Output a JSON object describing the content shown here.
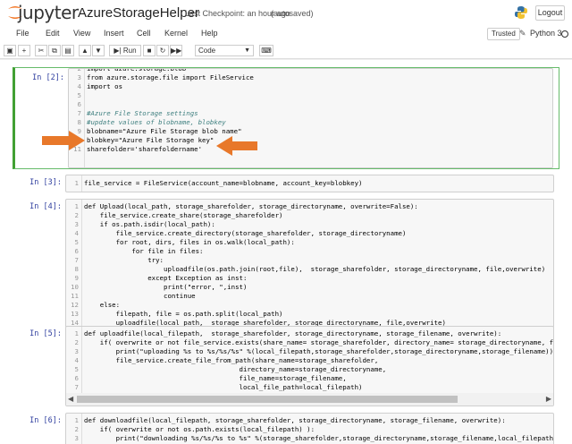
{
  "header": {
    "logo_text": "jupyter",
    "notebook_name": "AzureStorageHelper",
    "checkpoint": "Last Checkpoint: an hour ago",
    "autosave": "(autosaved)",
    "logout_label": "Logout"
  },
  "menubar": {
    "items": [
      "File",
      "Edit",
      "View",
      "Insert",
      "Cell",
      "Kernel",
      "Help"
    ],
    "trusted_label": "Trusted",
    "kernel_name": "Python 3"
  },
  "toolbar": {
    "run_label": "Run",
    "cell_type": "Code"
  },
  "cells": [
    {
      "prompt": "In [2]:",
      "selected": true,
      "lines": [
        {
          "n": "3",
          "text": "from azure.storage.file import FileService"
        },
        {
          "n": "4",
          "text": "import os"
        },
        {
          "n": "5",
          "text": ""
        },
        {
          "n": "6",
          "text": ""
        },
        {
          "n": "7",
          "text": "#Azure File Storage settings"
        },
        {
          "n": "8",
          "text": "#update values of blobname, blobkey"
        },
        {
          "n": "9",
          "text": "blobname=\"Azure File Storage blob name\""
        },
        {
          "n": "10",
          "text": "blobkey=\"Azure File Storage key\""
        },
        {
          "n": "11",
          "text": "sharefolder='sharefoldername'"
        }
      ]
    },
    {
      "prompt": "In [3]:",
      "lines": [
        {
          "n": "1",
          "text": "file_service = FileService(account_name=blobname, account_key=blobkey)"
        }
      ]
    },
    {
      "prompt": "In [4]:",
      "lines": [
        {
          "n": "1",
          "text": "def Upload(local_path, storage_sharefolder, storage_directoryname, overwrite=False):"
        },
        {
          "n": "2",
          "text": "    file_service.create_share(storage_sharefolder)"
        },
        {
          "n": "3",
          "text": "    if os.path.isdir(local_path):"
        },
        {
          "n": "4",
          "text": "        file_service.create_directory(storage_sharefolder, storage_directoryname)"
        },
        {
          "n": "5",
          "text": "        for root, dirs, files in os.walk(local_path):"
        },
        {
          "n": "6",
          "text": "            for file in files:"
        },
        {
          "n": "7",
          "text": "                try:"
        },
        {
          "n": "8",
          "text": "                    uploadfile(os.path.join(root,file),  storage_sharefolder, storage_directoryname, file,overwrite)"
        },
        {
          "n": "9",
          "text": "                except Exception as inst:"
        },
        {
          "n": "10",
          "text": "                    print(\"error, \",inst)"
        },
        {
          "n": "11",
          "text": "                    continue"
        },
        {
          "n": "12",
          "text": "    else:"
        },
        {
          "n": "13",
          "text": "        filepath, file = os.path.split(local_path)"
        },
        {
          "n": "14",
          "text": "        uploadfile(local_path,  storage_sharefolder, storage_directoryname, file,overwrite)"
        }
      ]
    },
    {
      "prompt": "In [5]:",
      "lines": [
        {
          "n": "1",
          "text": "def uploadfile(local_filepath,  storage_sharefolder, storage_directoryname, storage_filename, overwrite):"
        },
        {
          "n": "2",
          "text": "    if( overwrite or not file_service.exists(share_name= storage_sharefolder, directory_name= storage_directoryname, file_na"
        },
        {
          "n": "3",
          "text": "        print(\"uploading %s to %s/%s/%s\" %(local_filepath,storage_sharefolder,storage_directoryname,storage_filename))"
        },
        {
          "n": "4",
          "text": "        file_service.create_file_from_path(share_name=storage_sharefolder,"
        },
        {
          "n": "5",
          "text": "                                       directory_name=storage_directoryname,"
        },
        {
          "n": "6",
          "text": "                                       file_name=storage_filename,"
        },
        {
          "n": "7",
          "text": "                                       local_file_path=local_filepath)"
        }
      ]
    },
    {
      "prompt": "In [6]:",
      "lines": [
        {
          "n": "1",
          "text": "def downloadfile(local_filepath, storage_sharefolder, storage_directoryname, storage_filename, overwrite):"
        },
        {
          "n": "2",
          "text": "    if( overwrite or not os.path.exists(local_filepath) ):"
        },
        {
          "n": "3",
          "text": "        print(\"downloading %s/%s/%s to %s\" %(storage_sharefolder,storage_directoryname,storage_filename,local_filepath))"
        }
      ]
    }
  ],
  "colors": {
    "accent_arrow": "#e8782a",
    "selected_border": "#42a033",
    "prompt": "#303f9f",
    "keyword": "#008000",
    "string": "#ba2121",
    "comment": "#408080"
  }
}
